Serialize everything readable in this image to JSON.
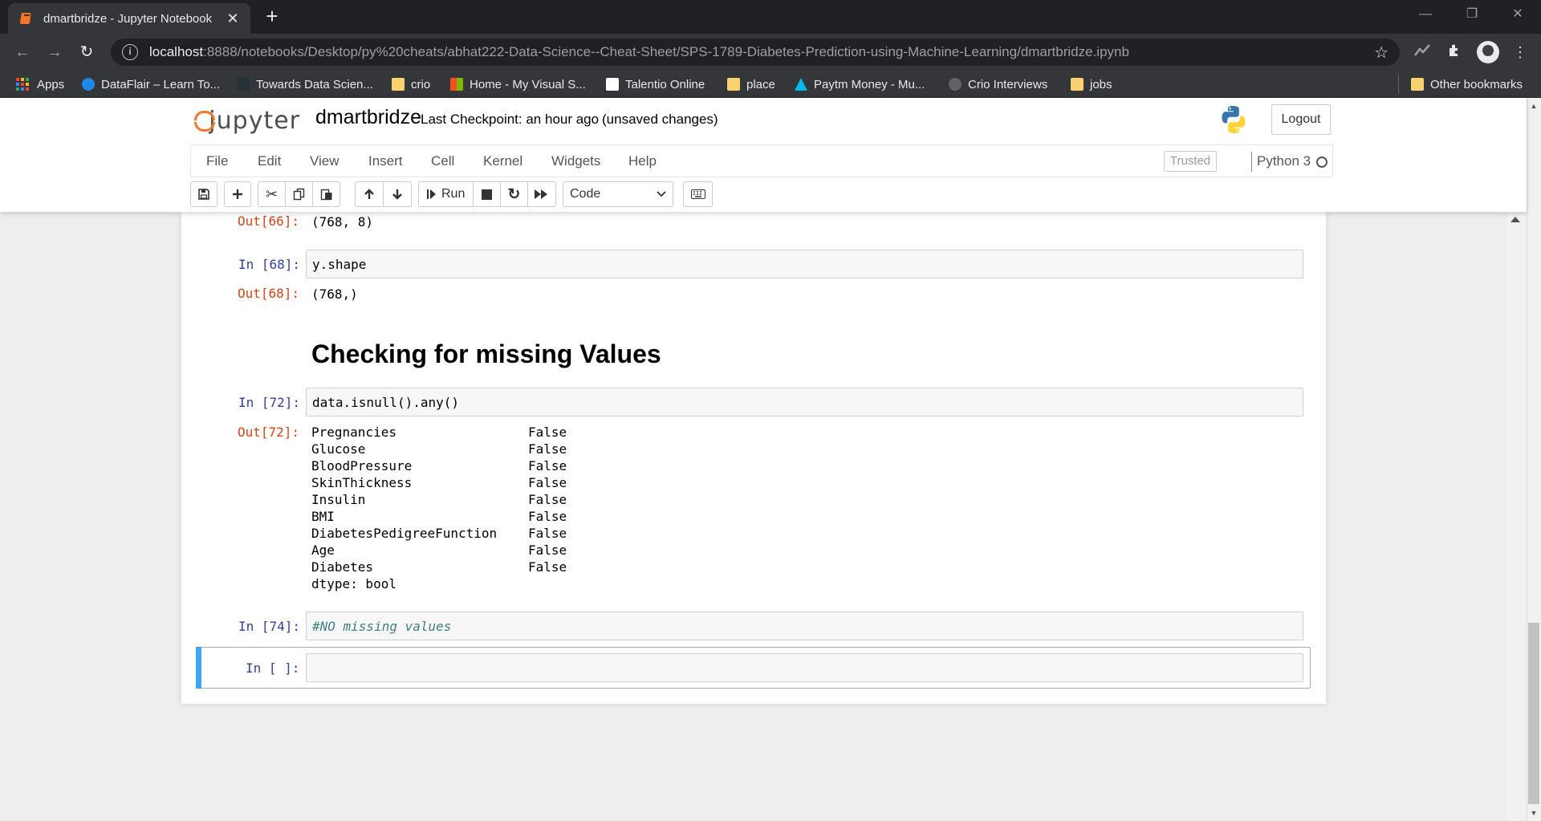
{
  "browser": {
    "tab_title": "dmartbridze - Jupyter Notebook",
    "tab_close": "✕",
    "new_tab": "+",
    "url_host": "localhost",
    "url_rest": ":8888/notebooks/Desktop/py%20cheats/abhat222-Data-Science--Cheat-Sheet/SPS-1789-Diabetes-Prediction-using-Machine-Learning/dmartbridze.ipynb",
    "bookmarks": [
      {
        "label": "Apps"
      },
      {
        "label": "DataFlair – Learn To..."
      },
      {
        "label": "Towards Data Scien..."
      },
      {
        "label": "crio"
      },
      {
        "label": "Home - My Visual S..."
      },
      {
        "label": "Talentio Online"
      },
      {
        "label": "place"
      },
      {
        "label": "Paytm Money - Mu..."
      },
      {
        "label": "Crio Interviews"
      },
      {
        "label": "jobs"
      }
    ],
    "other_bookmarks": "Other bookmarks",
    "icons": [
      "back-icon",
      "forward-icon",
      "reload-icon",
      "info-icon",
      "star-icon",
      "extensions-icon",
      "profile-icon"
    ]
  },
  "jupyter": {
    "logo_text": "jupyter",
    "notebook_name": "dmartbridze",
    "checkpoint": "Last Checkpoint: an hour ago",
    "autosave": "(unsaved changes)",
    "logout": "Logout",
    "menu": [
      "File",
      "Edit",
      "View",
      "Insert",
      "Cell",
      "Kernel",
      "Widgets",
      "Help"
    ],
    "trusted": "Trusted",
    "kernel": "Python 3",
    "run_label": "Run",
    "cell_type": "Code",
    "accent_color": "#f37726"
  },
  "cells": {
    "out66_prompt": "Out[66]:",
    "out66_text": "(768, 8)",
    "in68_prompt": "In [68]:",
    "in68_code": "y.shape",
    "out68_prompt": "Out[68]:",
    "out68_text": "(768,)",
    "md_heading": "Checking for missing Values",
    "in72_prompt": "In [72]:",
    "in72_code": "data.isnull().any()",
    "out72_prompt": "Out[72]:",
    "out72_rows": [
      {
        "key": "Pregnancies",
        "val": "False"
      },
      {
        "key": "Glucose",
        "val": "False"
      },
      {
        "key": "BloodPressure",
        "val": "False"
      },
      {
        "key": "SkinThickness",
        "val": "False"
      },
      {
        "key": "Insulin",
        "val": "False"
      },
      {
        "key": "BMI",
        "val": "False"
      },
      {
        "key": "DiabetesPedigreeFunction",
        "val": "False"
      },
      {
        "key": "Age",
        "val": "False"
      },
      {
        "key": "Diabetes",
        "val": "False"
      }
    ],
    "out72_dtype": "dtype: bool",
    "in74_prompt": "In [74]:",
    "in74_code": "#NO missing values",
    "in_empty_prompt": "In [ ]:",
    "in_empty_code": ""
  }
}
